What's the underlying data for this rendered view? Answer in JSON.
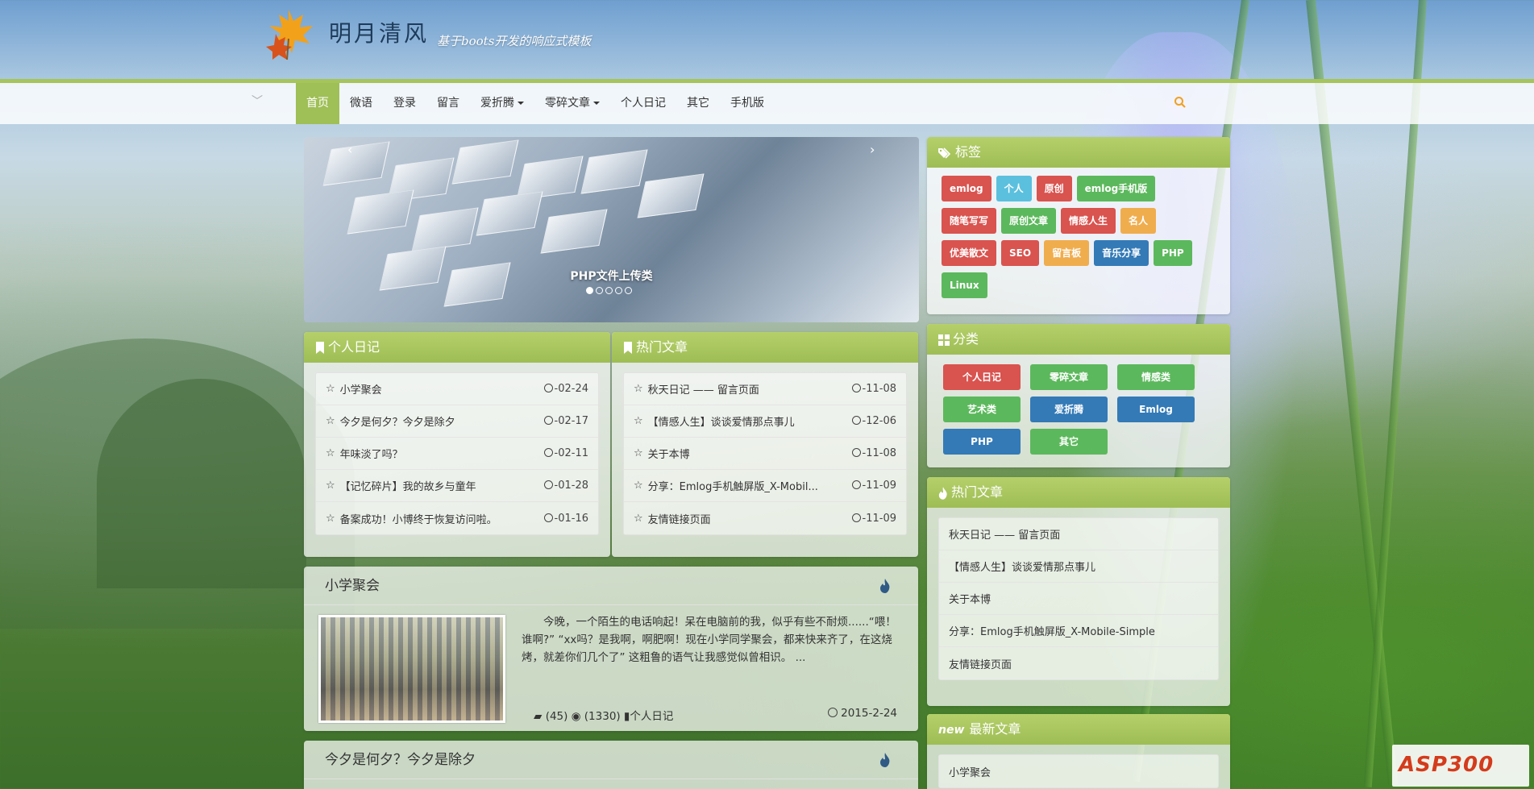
{
  "brand": {
    "title": "明月清风",
    "subtitle": "基于boots开发的响应式模板"
  },
  "nav": {
    "items": [
      {
        "label": "首页",
        "active": true,
        "dropdown": false
      },
      {
        "label": "微语",
        "active": false,
        "dropdown": false
      },
      {
        "label": "登录",
        "active": false,
        "dropdown": false
      },
      {
        "label": "留言",
        "active": false,
        "dropdown": false
      },
      {
        "label": "爱折腾",
        "active": false,
        "dropdown": true
      },
      {
        "label": "零碎文章",
        "active": false,
        "dropdown": true
      },
      {
        "label": "个人日记",
        "active": false,
        "dropdown": false
      },
      {
        "label": "其它",
        "active": false,
        "dropdown": false
      },
      {
        "label": "手机版",
        "active": false,
        "dropdown": false
      }
    ],
    "search_icon": "search-icon",
    "accent": "#9fbf57"
  },
  "carousel": {
    "caption": "PHP文件上传类",
    "dot_count": 5,
    "active_dot": 1
  },
  "diary": {
    "heading": "个人日记",
    "rows": [
      {
        "title": "小学聚会",
        "date": "-02-24"
      },
      {
        "title": "今夕是何夕？今夕是除夕",
        "date": "-02-17"
      },
      {
        "title": "年味淡了吗？",
        "date": "-02-11"
      },
      {
        "title": "【记忆碎片】我的故乡与童年",
        "date": "-01-28"
      },
      {
        "title": "备案成功！小博终于恢复访问啦。",
        "date": "-01-16"
      }
    ]
  },
  "hot": {
    "heading": "热门文章",
    "rows": [
      {
        "title": "秋天日记 —— 留言页面",
        "date": "-11-08"
      },
      {
        "title": "【情感人生】谈谈爱情那点事儿",
        "date": "-12-06"
      },
      {
        "title": "关于本博",
        "date": "-11-08"
      },
      {
        "title": "分享：Emlog手机触屏版_X-Mobil...",
        "date": "-11-09"
      },
      {
        "title": "友情链接页面",
        "date": "-11-09"
      }
    ]
  },
  "tags": {
    "heading": "标签",
    "items": [
      {
        "label": "emlog",
        "color": "#d9534f"
      },
      {
        "label": "个人",
        "color": "#5bc0de"
      },
      {
        "label": "原创",
        "color": "#d9534f"
      },
      {
        "label": "emlog手机版",
        "color": "#5cb85c"
      },
      {
        "label": "随笔写写",
        "color": "#d9534f"
      },
      {
        "label": "原创文章",
        "color": "#5cb85c"
      },
      {
        "label": "情感人生",
        "color": "#d9534f"
      },
      {
        "label": "名人",
        "color": "#f0ad4e"
      },
      {
        "label": "优美散文",
        "color": "#d9534f"
      },
      {
        "label": "SEO",
        "color": "#d9534f"
      },
      {
        "label": "留言板",
        "color": "#f0ad4e"
      },
      {
        "label": "音乐分享",
        "color": "#337ab7"
      },
      {
        "label": "PHP",
        "color": "#5cb85c"
      },
      {
        "label": "Linux",
        "color": "#5cb85c"
      }
    ]
  },
  "categories": {
    "heading": "分类",
    "items": [
      {
        "label": "个人日记",
        "color": "#d9534f"
      },
      {
        "label": "零碎文章",
        "color": "#5cb85c"
      },
      {
        "label": "情感类",
        "color": "#5cb85c"
      },
      {
        "label": "艺术类",
        "color": "#5cb85c"
      },
      {
        "label": "爱折腾",
        "color": "#337ab7"
      },
      {
        "label": "Emlog",
        "color": "#337ab7"
      },
      {
        "label": "PHP",
        "color": "#337ab7"
      },
      {
        "label": "其它",
        "color": "#5cb85c"
      }
    ]
  },
  "side_hot": {
    "heading": "热门文章",
    "rows": [
      "秋天日记 —— 留言页面",
      "【情感人生】谈谈爱情那点事儿",
      "关于本博",
      "分享：Emlog手机触屏版_X-Mobile-Simple",
      "友情链接页面"
    ]
  },
  "side_new": {
    "badge": "new",
    "heading": "最新文章",
    "rows": [
      "小学聚会"
    ]
  },
  "article1": {
    "title": "小学聚会",
    "excerpt": "今晚，一个陌生的电话响起！呆在电脑前的我，似乎有些不耐烦......“喂！谁啊?” “xx吗？是我啊，啊肥啊！现在小学同学聚会，都来快来齐了，在这烧烤，就差你们几个了” 这粗鲁的语气让我感觉似曾相识。 ...",
    "comments": "(45)",
    "views": "(1330)",
    "category": "个人日记",
    "date": "2015-2-24"
  },
  "article2": {
    "title": "今夕是何夕？今夕是除夕"
  },
  "watermark": {
    "text": "ASP300"
  }
}
